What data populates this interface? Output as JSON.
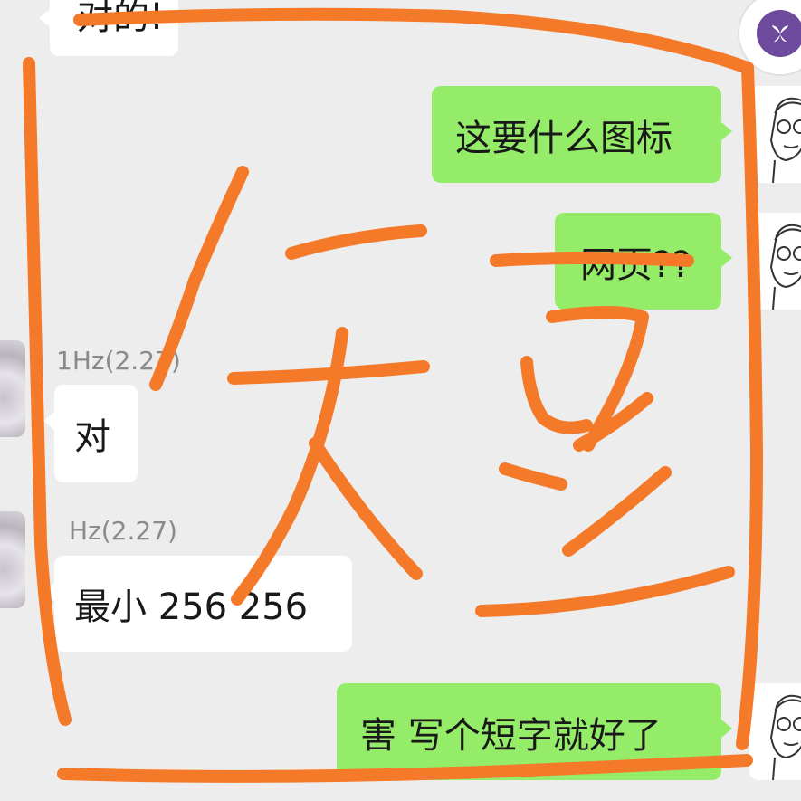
{
  "messages": [
    {
      "id": "m0",
      "side": "in",
      "text": "对的!"
    },
    {
      "id": "m1",
      "side": "out",
      "text": "这要什么图标"
    },
    {
      "id": "m2",
      "side": "out",
      "text": "网页??"
    },
    {
      "id": "m3",
      "side": "in",
      "sender": "1Hz(2.27)",
      "text": "对"
    },
    {
      "id": "m4",
      "side": "in",
      "sender": "Hz(2.27)",
      "text": "最小 256  256"
    },
    {
      "id": "m5",
      "side": "out",
      "text": "害 写个短字就好了"
    }
  ],
  "floating_badge": {
    "icon": "purple-flower-logo-icon"
  },
  "annotation": {
    "handwritten_char": "短",
    "stroke_color": "#f47a2a"
  },
  "colors": {
    "background": "#ededed",
    "bubble_out": "#95ec69",
    "bubble_in": "#ffffff",
    "sender_text": "#8a8a8a"
  }
}
